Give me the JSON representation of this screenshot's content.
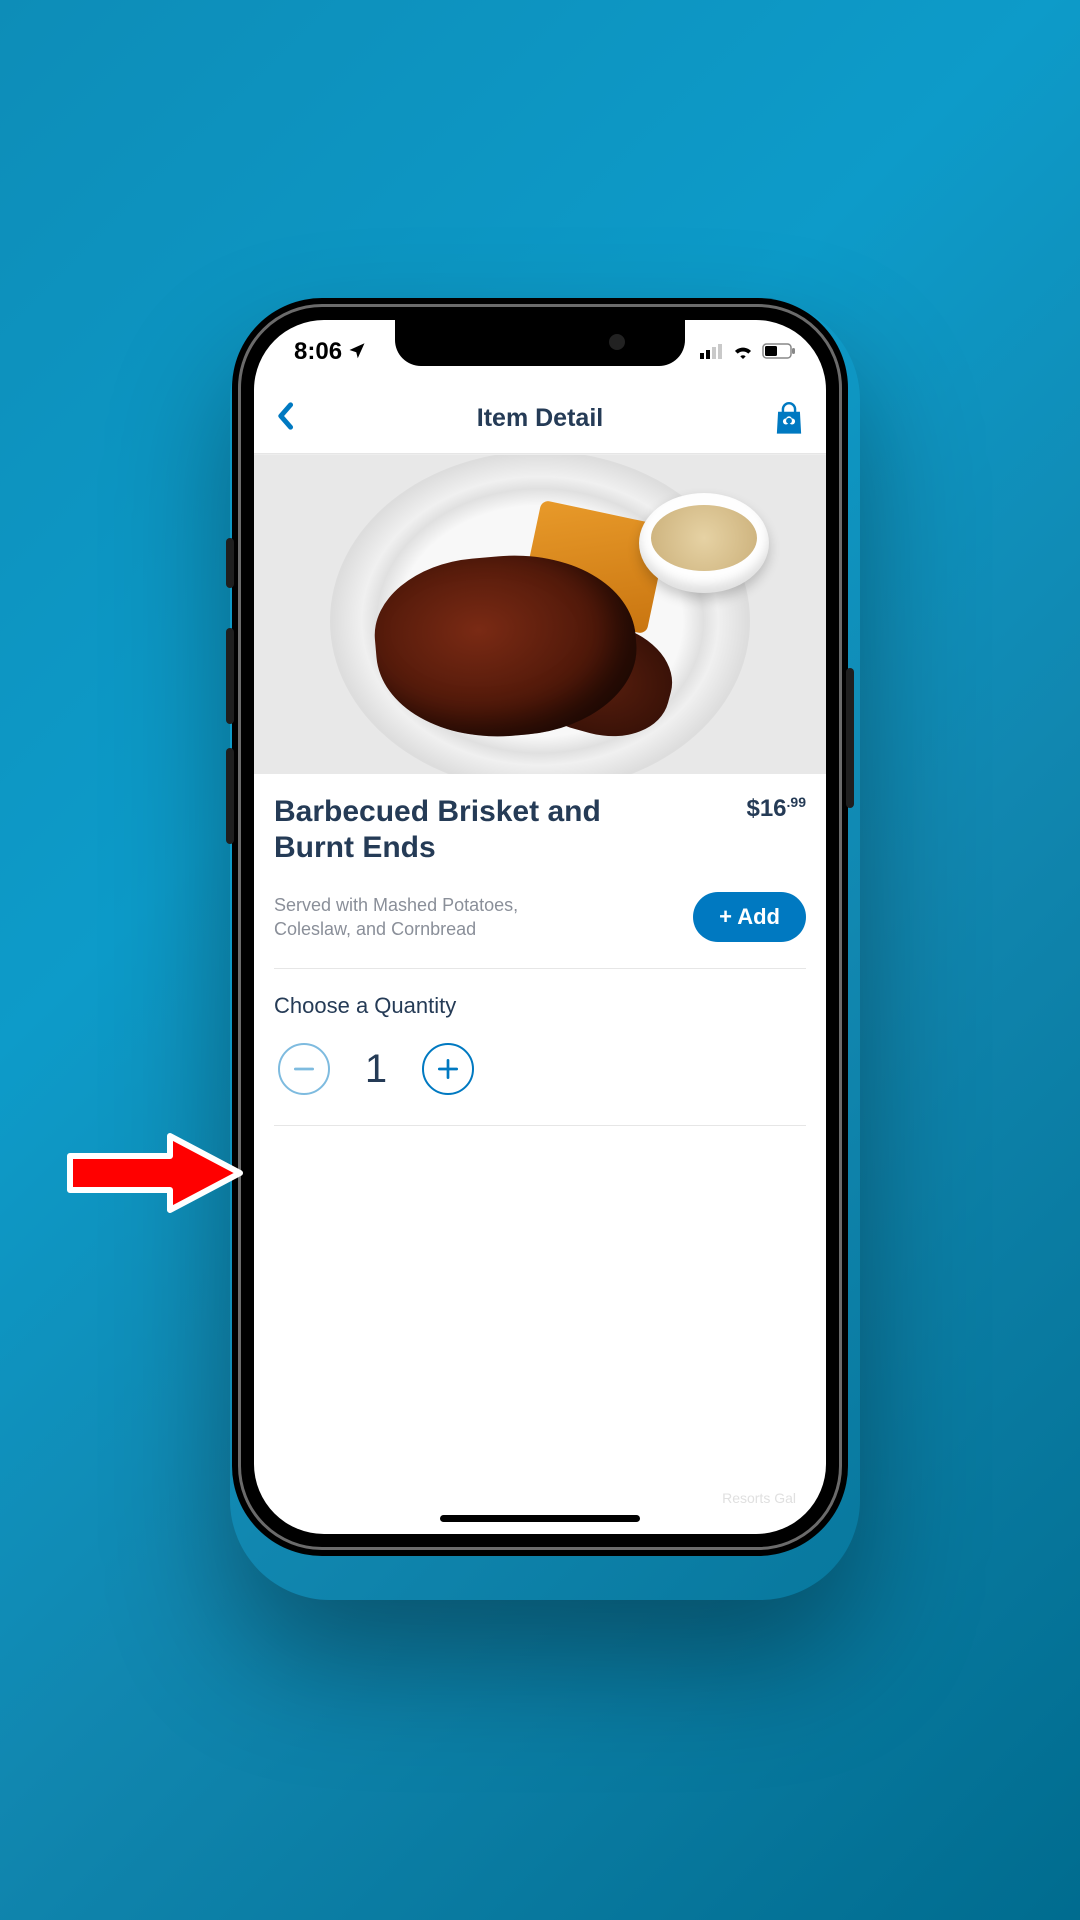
{
  "status": {
    "time": "8:06",
    "location_icon": "location-arrow",
    "signal_icon": "cellular-signal",
    "wifi_icon": "wifi",
    "battery_icon": "battery-half"
  },
  "nav": {
    "back": "‹",
    "title": "Item Detail",
    "bag_icon": "shopping-bag"
  },
  "item": {
    "title": "Barbecued Brisket and Burnt Ends",
    "price_dollars": "$16",
    "price_cents": ".99",
    "description": "Served with Mashed Potatoes, Coleslaw, and Cornbread",
    "add_label": "+ Add"
  },
  "quantity": {
    "label": "Choose a Quantity",
    "value": "1",
    "minus": "−",
    "plus": "+"
  },
  "watermark": "Resorts Gal"
}
